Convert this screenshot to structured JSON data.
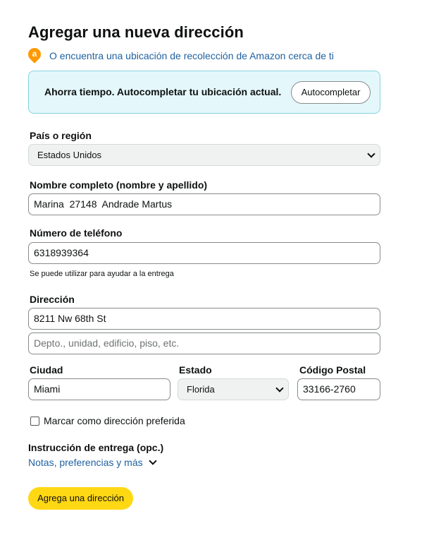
{
  "page": {
    "title": "Agregar una nueva dirección",
    "pickup_link": "O encuentra una ubicación de recolección de Amazon cerca de ti",
    "pickup_icon_glyph": "a",
    "pickup_icon": "location-pin-icon"
  },
  "autofill": {
    "text": "Ahorra tiempo. Autocompletar tu ubicación actual.",
    "button": "Autocompletar"
  },
  "country": {
    "label": "País o región",
    "value": "Estados Unidos"
  },
  "full_name": {
    "label": "Nombre completo (nombre y apellido)",
    "value": "Marina  27148  Andrade Martus"
  },
  "phone": {
    "label": "Número de teléfono",
    "value": "6318939364",
    "hint": "Se puede utilizar para ayudar a la entrega"
  },
  "address": {
    "label": "Dirección",
    "line1": "8211 Nw 68th St",
    "line2_placeholder": "Depto., unidad, edificio, piso, etc."
  },
  "city": {
    "label": "Ciudad",
    "value": "Miami"
  },
  "state": {
    "label": "Estado",
    "value": "Florida"
  },
  "postal": {
    "label": "Código Postal",
    "value": "33166-2760"
  },
  "preferred": {
    "label": "Marcar como dirección preferida",
    "checked": false
  },
  "instructions": {
    "title": "Instrucción de entrega (opc.)",
    "link": "Notas, preferencias y más"
  },
  "submit": {
    "label": "Agrega una dirección"
  },
  "colors": {
    "link": "#2162a1",
    "accent_orange": "#ff9900",
    "submit_yellow": "#ffd814",
    "autofill_bg": "#e4f7fb",
    "autofill_border": "#86d3e1"
  }
}
